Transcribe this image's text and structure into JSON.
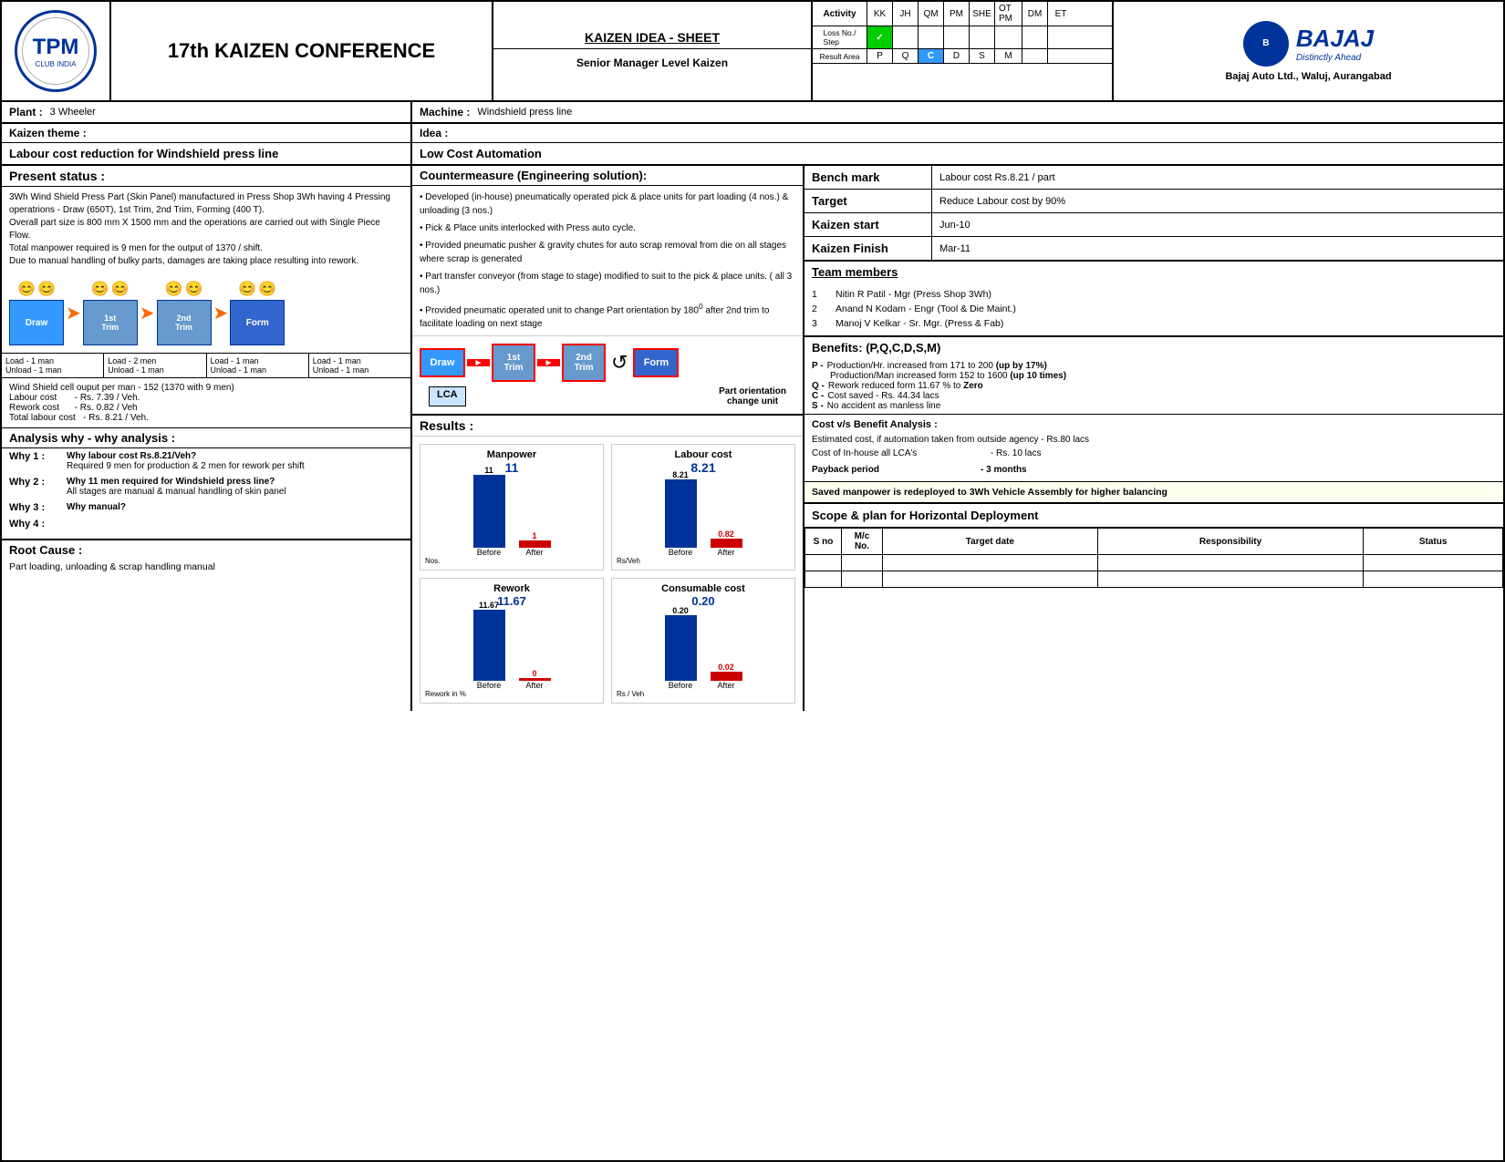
{
  "header": {
    "conference_title": "17th KAIZEN CONFERENCE",
    "kaizen_title": "KAIZEN IDEA - SHEET",
    "kaizen_subtitle": "Senior Manager Level Kaizen",
    "bajaj_brand": "BAJAJ",
    "bajaj_tagline": "Distinctly Ahead",
    "bajaj_address": "Bajaj Auto Ltd., Waluj, Aurangabad",
    "activity_label": "Activity",
    "columns": [
      "KK",
      "JH",
      "QM",
      "PM",
      "SHE",
      "OT PM",
      "DM",
      "ET"
    ],
    "row_loss_no": "Loss No./ Step",
    "row_result": "Result Area",
    "result_values": [
      "P",
      "Q",
      "C",
      "D",
      "S",
      "M"
    ],
    "green_check": "✓"
  },
  "plant": {
    "label": "Plant :",
    "value": "3 Wheeler"
  },
  "machine": {
    "label": "Machine :",
    "value": "Windshield press line"
  },
  "kaizen_theme": {
    "label": "Kaizen theme :",
    "value": "Labour cost reduction for Windshield press line"
  },
  "idea": {
    "label": "Idea  :",
    "value": "Low Cost Automation"
  },
  "present_status": {
    "header": "Present status :",
    "content": "3Wh Wind Shield Press Part (Skin Panel) manufactured in Press Shop 3Wh having 4 Pressing operatrions - Draw (650T), 1st Trim, 2nd Trim, Forming (400 T). Overall part size is 800 mm X 1500 mm and the operations are carried out with Single Piece Flow.\nTotal manpower required is 9 men for the output of 1370 / shift.\nDue to manual handling of bulky parts, damages are taking place resulting into rework.",
    "process": [
      {
        "label": "Draw",
        "persons": 2
      },
      {
        "label": "1st\nTrim",
        "persons": 2
      },
      {
        "label": "2nd\nTrim",
        "persons": 2
      },
      {
        "label": "Form",
        "persons": 2
      }
    ],
    "load_unload": [
      {
        "load": "Load  - 1 man",
        "unload": "Unload - 1 man"
      },
      {
        "load": "Load  - 2 men",
        "unload": "Unload - 1 man"
      },
      {
        "load": "Load  - 1 man",
        "unload": "Unload - 1 man"
      },
      {
        "load": "Load  - 1 man",
        "unload": "Unload - 1 man"
      }
    ],
    "stats": [
      "Wind Shield cell ouput per man - 152 (1370 with 9 men)",
      "Labour cost      - Rs. 7.39 /  Veh.",
      "Rework cost      - Rs. 0.82 / Veh",
      "Total labour cost  - Rs. 8.21 / Veh."
    ]
  },
  "why_why": {
    "header": "Analysis why - why analysis :",
    "items": [
      {
        "label": "Why 1 :",
        "question": "Why labour cost Rs.8.21/Veh?",
        "answer": "Required 9 men for production & 2 men for rework per shift"
      },
      {
        "label": "Why 2 :",
        "question": "Why 11 men required for Windshield press line?",
        "answer": "All stages are manual & manual handling of skin panel"
      },
      {
        "label": "Why 3 :",
        "question": "Why manual?"
      },
      {
        "label": "Why 4 :",
        "question": ""
      }
    ]
  },
  "root_cause": {
    "header": "Root Cause :",
    "value": "Part loading, unloading & scrap handling manual"
  },
  "countermeasure": {
    "header": "Countermeasure (Engineering solution):",
    "items": [
      "• Developed (in-house) pneumatically operated pick & place units for part loading (4 nos.) & unloading (3 nos.)",
      "• Pick & Place units interlocked with Press auto cycle.",
      "• Provided pneumatic pusher & gravity chutes for auto scrap removal from die on all stages where scrap is generated",
      "• Part transfer conveyor (from stage to stage) modified to suit to the pick & place units. ( all 3 nos.)",
      "• Provided pneumatic operated unit to change Part orientation by 180° after 2nd trim to facilitate loading on next stage"
    ],
    "after_flow_labels": [
      "Draw",
      "1st\nTrim",
      "2nd\nTrim",
      "Form"
    ],
    "lca_label": "LCA",
    "orientation_label": "Part orientation\nchange unit"
  },
  "results": {
    "header": "Results :",
    "manpower": {
      "title": "Manpower",
      "before_val": "11",
      "after_val": "1",
      "before_label": "Before",
      "after_label": "After",
      "y_max": 12,
      "y_axis_label": "Nos."
    },
    "labour_cost": {
      "title": "Labour cost",
      "before_val": "8.21",
      "after_val": "0.82",
      "before_label": "Before",
      "after_label": "After",
      "y_max": 10,
      "y_axis_label": "Rs/Veh"
    },
    "rework": {
      "title": "Rework",
      "before_val": "11.67",
      "after_val": "0",
      "before_label": "Before",
      "after_label": "After",
      "y_max": 14,
      "y_axis_label": "Rework in %"
    },
    "consumable_cost": {
      "title": "Consumable cost",
      "before_val": "0.20",
      "after_val": "0.02",
      "before_label": "Before",
      "after_label": "After",
      "y_max": 0.25,
      "y_axis_label": "Rs / Veh"
    }
  },
  "bench_mark": {
    "label": "Bench mark",
    "value": "Labour cost Rs.8.21 / part"
  },
  "target": {
    "label": "Target",
    "value": "Reduce Labour cost by 90%"
  },
  "kaizen_start": {
    "label": "Kaizen start",
    "value": "Jun-10"
  },
  "kaizen_finish": {
    "label": "Kaizen Finish",
    "value": "Mar-11"
  },
  "team_members": {
    "header": "Team members",
    "members": [
      {
        "no": "1",
        "name": "Nitin R Patil - Mgr (Press Shop 3Wh)"
      },
      {
        "no": "2",
        "name": "Anand N Kodam - Engr (Tool & Die Maint.)"
      },
      {
        "no": "3",
        "name": "Manoj V Kelkar - Sr. Mgr. (Press & Fab)"
      }
    ]
  },
  "benefits": {
    "header": "Benefits: (P,Q,C,D,S,M)",
    "items": [
      {
        "key": "P -",
        "text": "Production/Hr. increased from 171 to 200 ",
        "bold_part": "(up by 17%)"
      },
      {
        "key": "",
        "text": "Production/Man increased form 152 to 1600 ",
        "bold_part": "(up 10 times)"
      },
      {
        "key": "Q -",
        "text": "Rework reduced form 11.67 % to ",
        "bold_part": "Zero"
      },
      {
        "key": "C -",
        "text": "Cost saved - Rs. 44.34 lacs"
      },
      {
        "key": "S -",
        "text": "No accident as manless line"
      }
    ]
  },
  "cost_benefit": {
    "header": "Cost v/s Benefit Analysis :",
    "lines": [
      "Estimated cost, if automation taken from outside agency - Rs.80 lacs",
      "Cost of In-house all LCA's                                         - Rs. 10 lacs"
    ],
    "payback_label": "Payback period",
    "payback_value": "- 3 months"
  },
  "saved": {
    "text": "Saved manpower is redeployed to 3Wh Vehicle Assembly for higher balancing"
  },
  "scope": {
    "header": "Scope & plan for Horizontal Deployment",
    "table_headers": [
      "S no",
      "M/c\nNo.",
      "Target date",
      "Responsibility",
      "Status"
    ]
  }
}
